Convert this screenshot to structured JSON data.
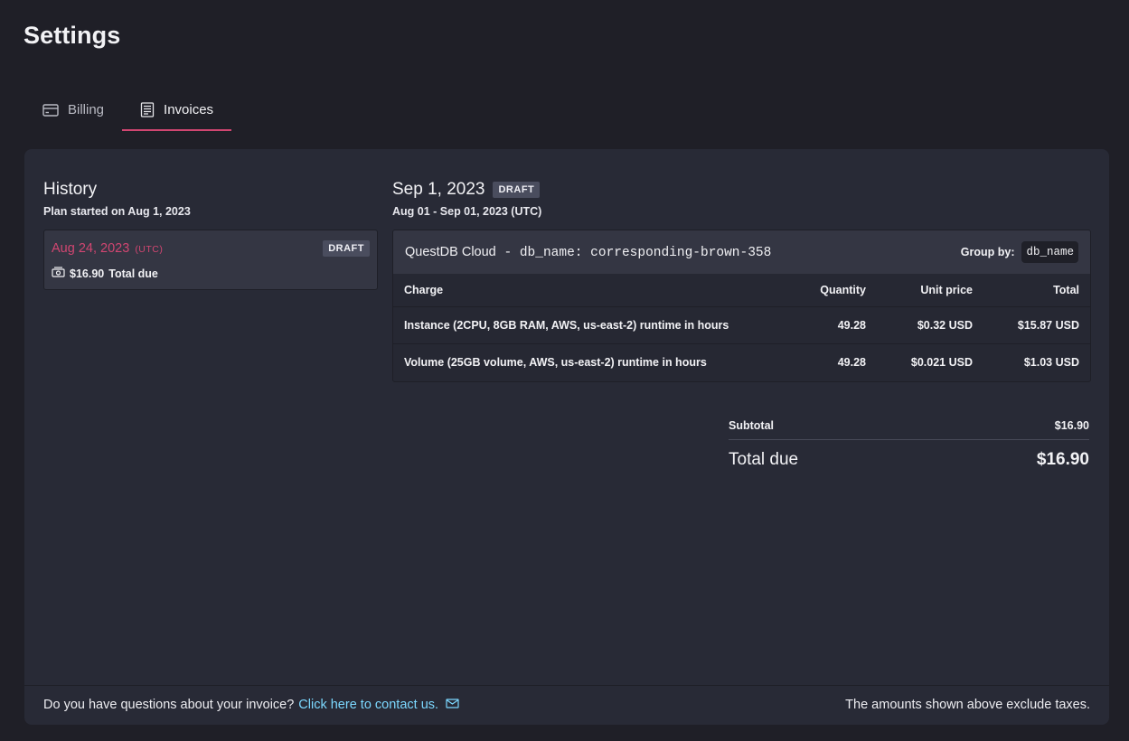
{
  "page": {
    "title": "Settings"
  },
  "tabs": [
    {
      "label": "Billing",
      "icon": "credit-card-icon",
      "active": false
    },
    {
      "label": "Invoices",
      "icon": "invoice-icon",
      "active": true
    }
  ],
  "history": {
    "title": "History",
    "plan_started": "Plan started on Aug 1, 2023",
    "items": [
      {
        "date": "Aug 24, 2023",
        "tz": "(UTC)",
        "badge": "DRAFT",
        "amount": "$16.90",
        "amount_label": "Total due"
      }
    ]
  },
  "invoice": {
    "date": "Sep 1, 2023",
    "badge": "DRAFT",
    "period": "Aug 01 - Sep 01, 2023 (UTC)",
    "product": "QuestDB Cloud",
    "db_label": "- db_name: corresponding-brown-358",
    "group_by_label": "Group by:",
    "group_by_value": "db_name",
    "columns": {
      "charge": "Charge",
      "quantity": "Quantity",
      "unit_price": "Unit price",
      "total": "Total"
    },
    "rows": [
      {
        "charge": "Instance (2CPU, 8GB RAM, AWS, us-east-2) runtime in hours",
        "quantity": "49.28",
        "unit_price": "$0.32 USD",
        "total": "$15.87 USD"
      },
      {
        "charge": "Volume (25GB volume, AWS, us-east-2) runtime in hours",
        "quantity": "49.28",
        "unit_price": "$0.021 USD",
        "total": "$1.03 USD"
      }
    ],
    "subtotal_label": "Subtotal",
    "subtotal_value": "$16.90",
    "total_label": "Total due",
    "total_value": "$16.90"
  },
  "footer": {
    "question": "Do you have questions about your invoice?",
    "contact_link": "Click here to contact us.",
    "tax_note": "The amounts shown above exclude taxes."
  },
  "colors": {
    "accent": "#d14671",
    "link": "#7cd8ff",
    "background": "#1f1f27",
    "panel": "#282a36"
  }
}
